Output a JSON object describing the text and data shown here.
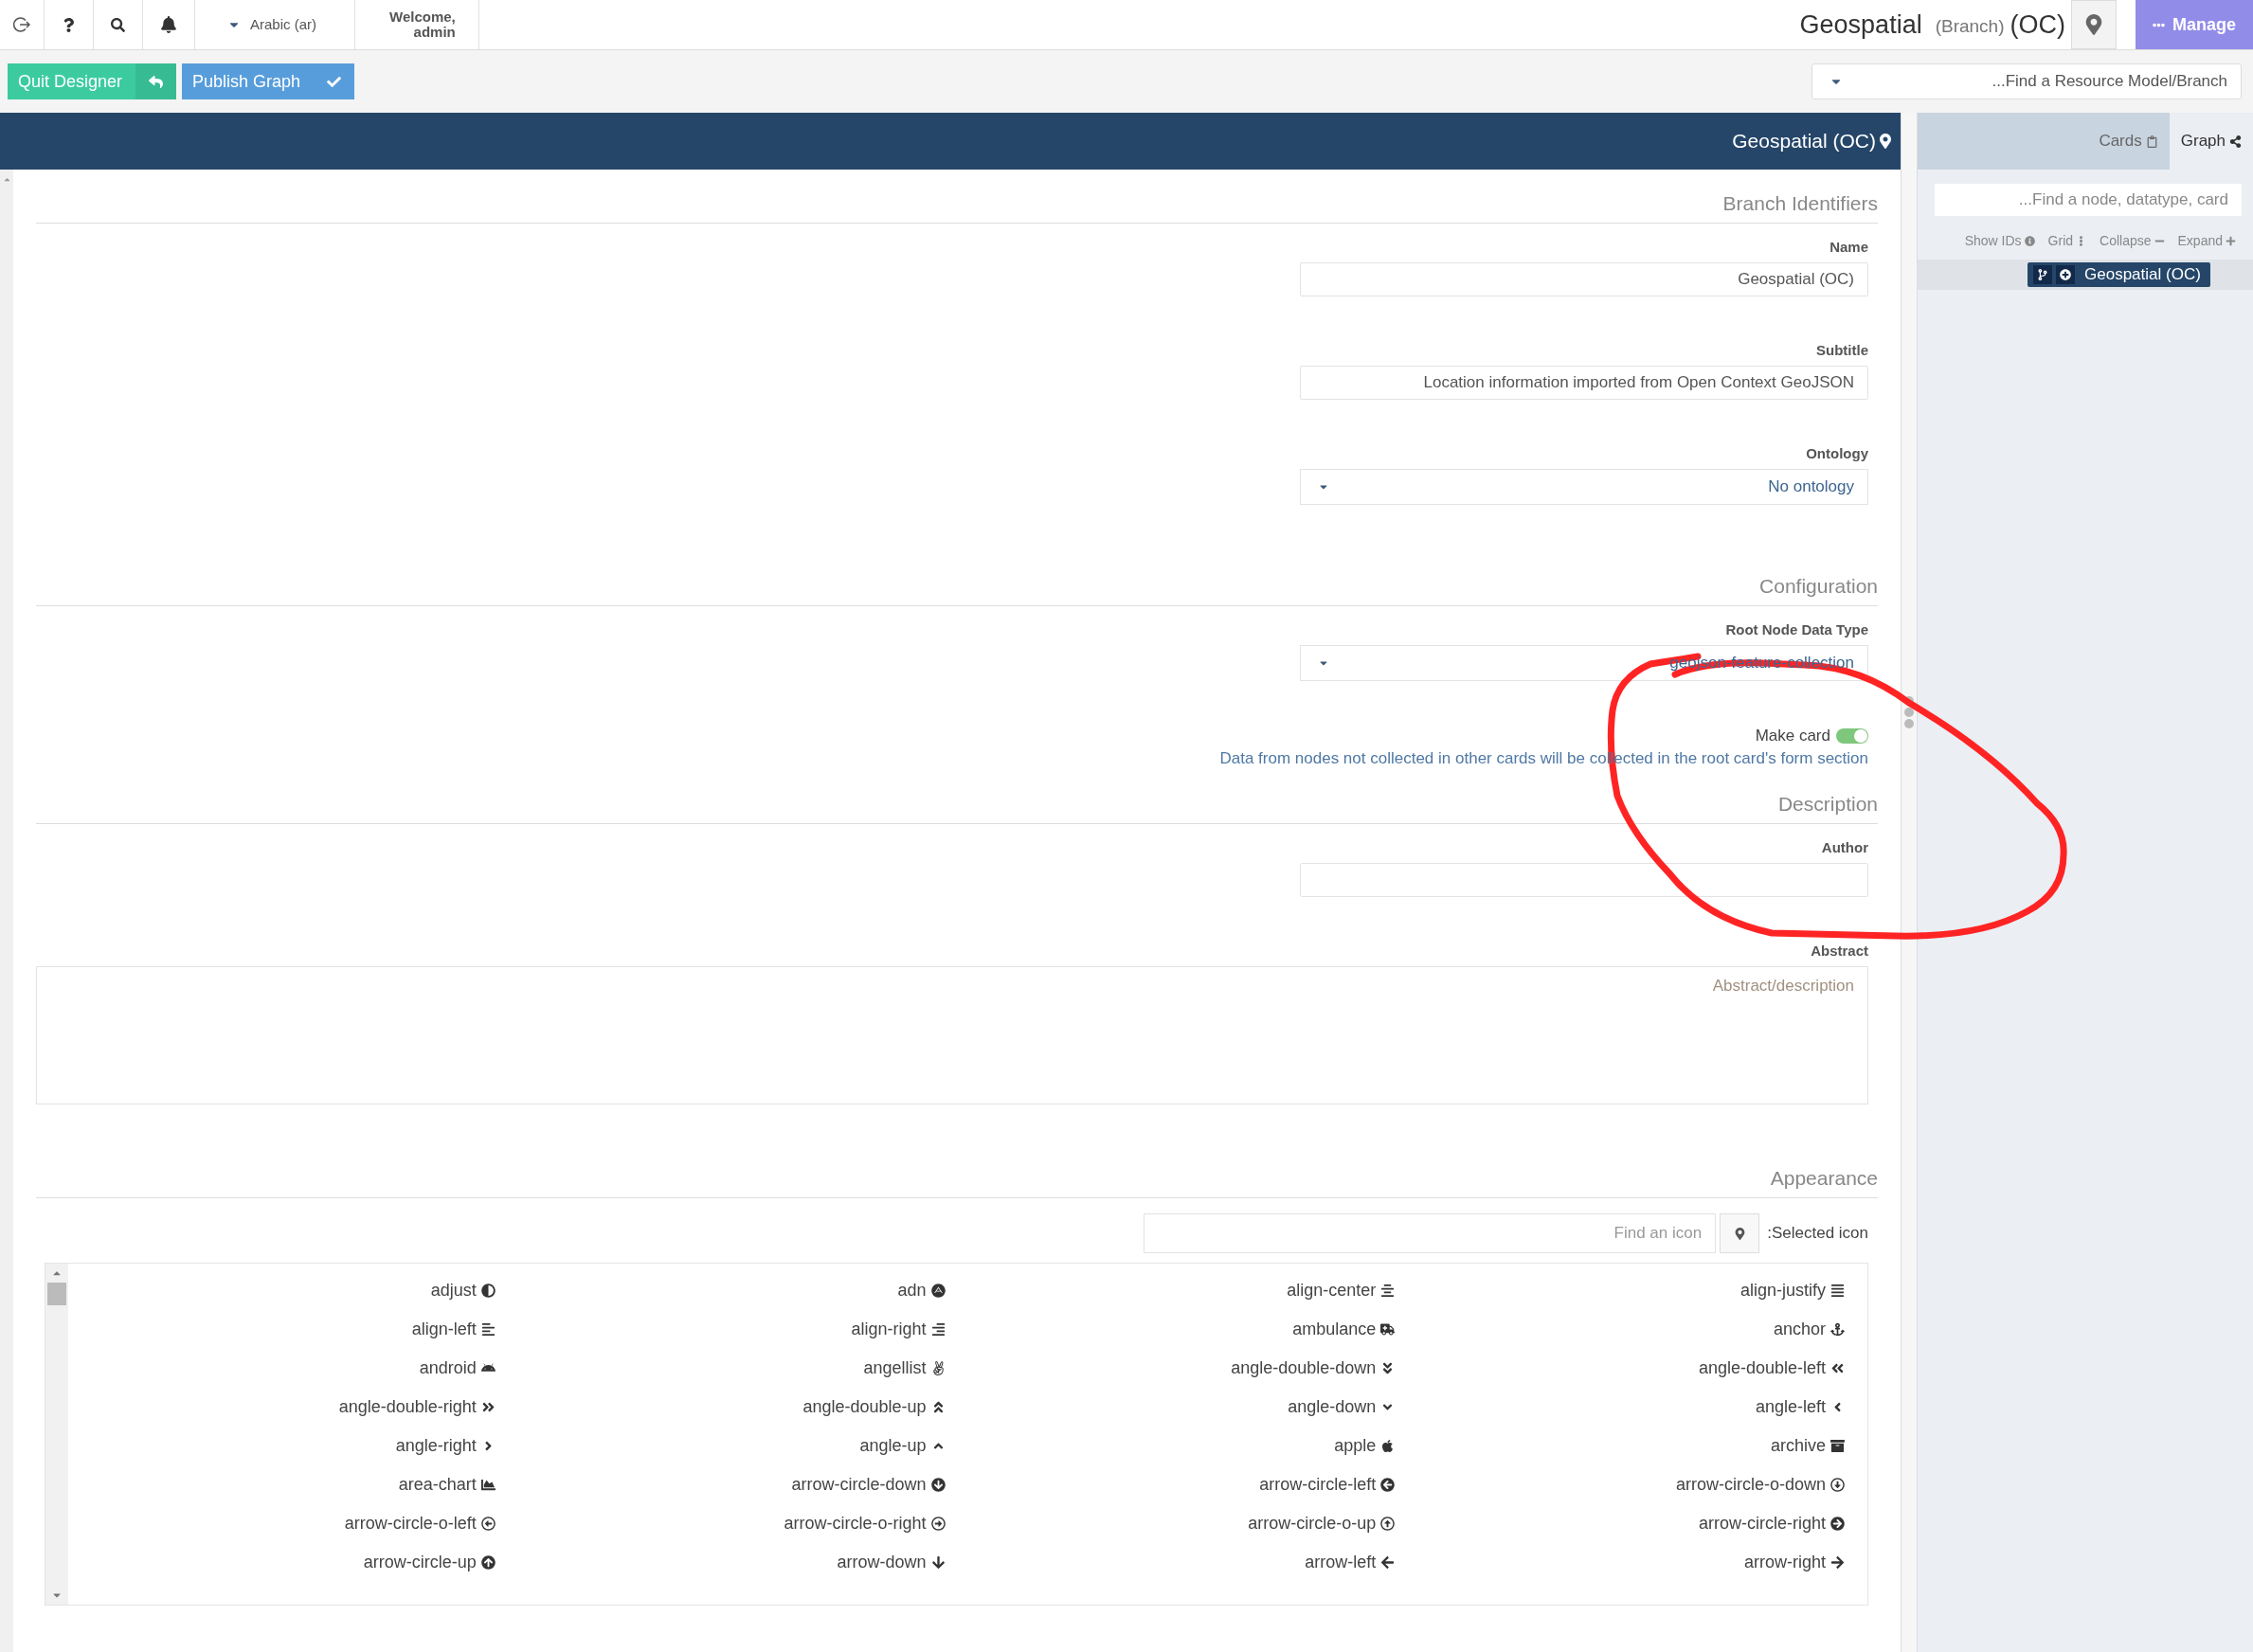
{
  "top_bar": {
    "language": "Arabic (ar)",
    "welcome": "Welcome,\nadmin",
    "title": "Geospatial",
    "title_branch": "(Branch)",
    "title_suffix": "(OC)",
    "manage": "Manage"
  },
  "toolbar": {
    "quit": "Quit Designer",
    "publish": "Publish Graph",
    "find_placeholder": "...Find a Resource Model/Branch"
  },
  "panel_header": "Geospatial (OC)",
  "sections": [
    {
      "title": "Branch Identifiers",
      "fields": [
        {
          "kind": "text",
          "label": "Name",
          "value": "Geospatial (OC)"
        },
        {
          "kind": "text",
          "label": "Subtitle",
          "value": "Location information imported from Open Context GeoJSON"
        },
        {
          "kind": "select",
          "label": "Ontology",
          "value": "No ontology"
        }
      ]
    },
    {
      "title": "Configuration",
      "fields": [
        {
          "kind": "select",
          "label": "Root Node Data Type",
          "value": "geojson-feature-collection"
        },
        {
          "kind": "toggle",
          "label": "Make card",
          "on": true,
          "help": "Data from nodes not collected in other cards will be collected in the root card's form section"
        }
      ]
    },
    {
      "title": "Description",
      "fields": [
        {
          "kind": "text",
          "label": "Author"
        },
        {
          "kind": "textarea",
          "label": "Abstract",
          "placeholder": "Abstract/description"
        }
      ]
    },
    {
      "title": "Appearance",
      "fields": [
        {
          "kind": "icon-picker",
          "placeholder": "Find an icon",
          "selected_label": ":Selected icon",
          "icons": [
            "adjust",
            "adn",
            "align-center",
            "align-justify",
            "align-left",
            "align-right",
            "ambulance",
            "anchor",
            "android",
            "angellist",
            "angle-double-down",
            "angle-double-left",
            "angle-double-right",
            "angle-double-up",
            "angle-down",
            "angle-left",
            "angle-right",
            "angle-up",
            "apple",
            "archive",
            "area-chart",
            "arrow-circle-down",
            "arrow-circle-left",
            "arrow-circle-o-down",
            "arrow-circle-o-left",
            "arrow-circle-o-right",
            "arrow-circle-o-up",
            "arrow-circle-right",
            "arrow-circle-up",
            "arrow-down",
            "arrow-left",
            "arrow-right"
          ]
        }
      ]
    }
  ],
  "side_panel": {
    "tabs": [
      {
        "label": "Cards",
        "selected": false
      },
      {
        "label": "Graph",
        "selected": true
      }
    ],
    "search_placeholder": "...Find a node, datatype, card",
    "tools": [
      "Show IDs",
      "Grid",
      "Collapse",
      "Expand"
    ],
    "node": "Geospatial (OC)"
  },
  "annotation": {
    "kind": "circle"
  }
}
